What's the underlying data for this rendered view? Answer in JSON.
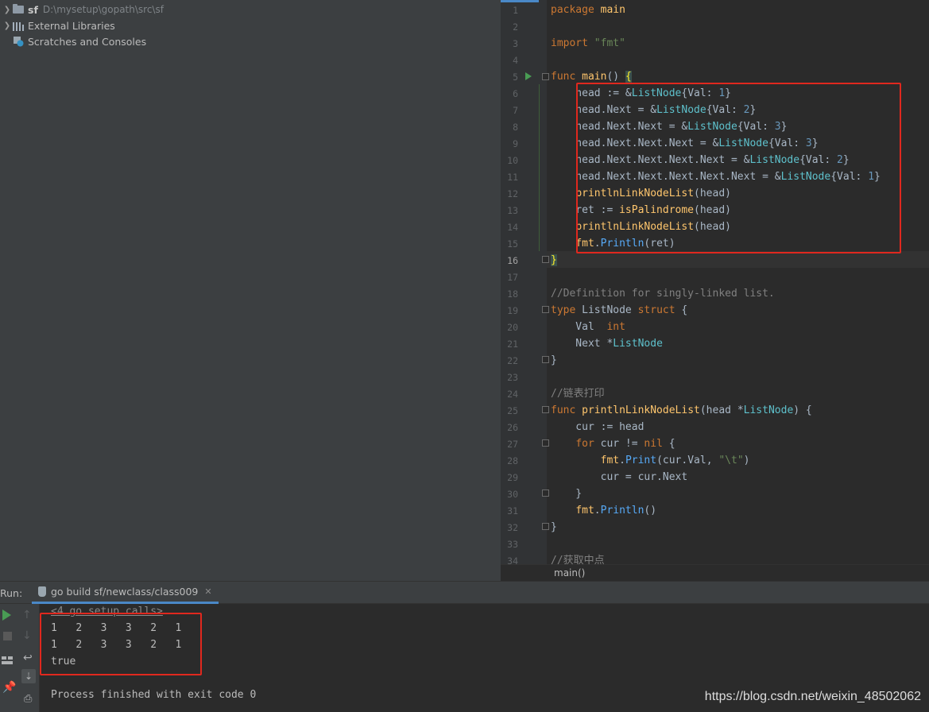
{
  "project_tree": {
    "root_name": "sf",
    "root_path": "D:\\mysetup\\gopath\\src\\sf",
    "items": [
      {
        "label": "External Libraries"
      },
      {
        "label": "Scratches and Consoles"
      }
    ]
  },
  "editor": {
    "line_numbers": [
      "1",
      "2",
      "3",
      "4",
      "5",
      "6",
      "7",
      "8",
      "9",
      "10",
      "11",
      "12",
      "13",
      "14",
      "15",
      "16",
      "17",
      "18",
      "19",
      "20",
      "21",
      "22",
      "23",
      "24",
      "25",
      "26",
      "27",
      "28",
      "29",
      "30",
      "31",
      "32",
      "33",
      "34"
    ],
    "current_line": "16",
    "lines": [
      [
        {
          "t": "package ",
          "c": "kw"
        },
        {
          "t": "main",
          "c": "fn"
        }
      ],
      [],
      [
        {
          "t": "import ",
          "c": "kw"
        },
        {
          "t": "\"fmt\"",
          "c": "str"
        }
      ],
      [],
      [
        {
          "t": "func ",
          "c": "kw"
        },
        {
          "t": "main",
          "c": "fn"
        },
        {
          "t": "() ",
          "c": "plain"
        },
        {
          "t": "{",
          "c": "brace-hl"
        }
      ],
      [
        {
          "t": "    head := &",
          "c": "plain"
        },
        {
          "t": "ListNode",
          "c": "ty"
        },
        {
          "t": "{Val: ",
          "c": "plain"
        },
        {
          "t": "1",
          "c": "num"
        },
        {
          "t": "}",
          "c": "plain"
        }
      ],
      [
        {
          "t": "    head.Next = &",
          "c": "plain"
        },
        {
          "t": "ListNode",
          "c": "ty"
        },
        {
          "t": "{Val: ",
          "c": "plain"
        },
        {
          "t": "2",
          "c": "num"
        },
        {
          "t": "}",
          "c": "plain"
        }
      ],
      [
        {
          "t": "    head.Next.Next = &",
          "c": "plain"
        },
        {
          "t": "ListNode",
          "c": "ty"
        },
        {
          "t": "{Val: ",
          "c": "plain"
        },
        {
          "t": "3",
          "c": "num"
        },
        {
          "t": "}",
          "c": "plain"
        }
      ],
      [
        {
          "t": "    head.Next.Next.Next = &",
          "c": "plain"
        },
        {
          "t": "ListNode",
          "c": "ty"
        },
        {
          "t": "{Val: ",
          "c": "plain"
        },
        {
          "t": "3",
          "c": "num"
        },
        {
          "t": "}",
          "c": "plain"
        }
      ],
      [
        {
          "t": "    head.Next.Next.Next.Next = &",
          "c": "plain"
        },
        {
          "t": "ListNode",
          "c": "ty"
        },
        {
          "t": "{Val: ",
          "c": "plain"
        },
        {
          "t": "2",
          "c": "num"
        },
        {
          "t": "}",
          "c": "plain"
        }
      ],
      [
        {
          "t": "    head.Next.Next.Next.Next.Next = &",
          "c": "plain"
        },
        {
          "t": "ListNode",
          "c": "ty"
        },
        {
          "t": "{Val: ",
          "c": "plain"
        },
        {
          "t": "1",
          "c": "num"
        },
        {
          "t": "}",
          "c": "plain"
        }
      ],
      [
        {
          "t": "    ",
          "c": "plain"
        },
        {
          "t": "printlnLinkNodeList",
          "c": "fn"
        },
        {
          "t": "(head)",
          "c": "plain"
        }
      ],
      [
        {
          "t": "    ret := ",
          "c": "plain"
        },
        {
          "t": "isPalindrome",
          "c": "fn"
        },
        {
          "t": "(head)",
          "c": "plain"
        }
      ],
      [
        {
          "t": "    ",
          "c": "plain"
        },
        {
          "t": "printlnLinkNodeList",
          "c": "fn"
        },
        {
          "t": "(head)",
          "c": "plain"
        }
      ],
      [
        {
          "t": "    ",
          "c": "plain"
        },
        {
          "t": "fmt",
          "c": "fn"
        },
        {
          "t": ".",
          "c": "plain"
        },
        {
          "t": "Println",
          "c": "fc"
        },
        {
          "t": "(ret)",
          "c": "plain"
        }
      ],
      [
        {
          "t": "}",
          "c": "brace-hl"
        }
      ],
      [],
      [
        {
          "t": "//Definition for singly-linked list.",
          "c": "cm"
        }
      ],
      [
        {
          "t": "type ",
          "c": "kw"
        },
        {
          "t": "ListNode ",
          "c": "plain"
        },
        {
          "t": "struct ",
          "c": "kw"
        },
        {
          "t": "{",
          "c": "plain"
        }
      ],
      [
        {
          "t": "    Val  ",
          "c": "plain"
        },
        {
          "t": "int",
          "c": "kw"
        }
      ],
      [
        {
          "t": "    Next *",
          "c": "plain"
        },
        {
          "t": "ListNode",
          "c": "ty"
        }
      ],
      [
        {
          "t": "}",
          "c": "plain"
        }
      ],
      [],
      [
        {
          "t": "//链表打印",
          "c": "cm"
        }
      ],
      [
        {
          "t": "func ",
          "c": "kw"
        },
        {
          "t": "printlnLinkNodeList",
          "c": "fn"
        },
        {
          "t": "(head *",
          "c": "plain"
        },
        {
          "t": "ListNode",
          "c": "ty"
        },
        {
          "t": ") {",
          "c": "plain"
        }
      ],
      [
        {
          "t": "    cur := head",
          "c": "plain"
        }
      ],
      [
        {
          "t": "    ",
          "c": "plain"
        },
        {
          "t": "for ",
          "c": "kw"
        },
        {
          "t": "cur != ",
          "c": "plain"
        },
        {
          "t": "nil ",
          "c": "kw"
        },
        {
          "t": "{",
          "c": "plain"
        }
      ],
      [
        {
          "t": "        ",
          "c": "plain"
        },
        {
          "t": "fmt",
          "c": "fn"
        },
        {
          "t": ".",
          "c": "plain"
        },
        {
          "t": "Print",
          "c": "fc"
        },
        {
          "t": "(cur.Val, ",
          "c": "plain"
        },
        {
          "t": "\"\\t\"",
          "c": "str"
        },
        {
          "t": ")",
          "c": "plain"
        }
      ],
      [
        {
          "t": "        cur = cur.Next",
          "c": "plain"
        }
      ],
      [
        {
          "t": "    }",
          "c": "plain"
        }
      ],
      [
        {
          "t": "    ",
          "c": "plain"
        },
        {
          "t": "fmt",
          "c": "fn"
        },
        {
          "t": ".",
          "c": "plain"
        },
        {
          "t": "Println",
          "c": "fc"
        },
        {
          "t": "()",
          "c": "plain"
        }
      ],
      [
        {
          "t": "}",
          "c": "plain"
        }
      ],
      [],
      [
        {
          "t": "//获取中点",
          "c": "cm"
        }
      ]
    ],
    "breadcrumb": "main()"
  },
  "run_panel": {
    "label": "Run:",
    "tab_label": "go build sf/newclass/class009",
    "hidden_calls": "<4 go setup calls>",
    "output_lines": [
      "1\t2\t3\t3\t2\t1",
      "1\t2\t3\t3\t2\t1",
      "true"
    ],
    "exit_message": "Process finished with exit code 0"
  },
  "watermark": "https://blog.csdn.net/weixin_48502062"
}
